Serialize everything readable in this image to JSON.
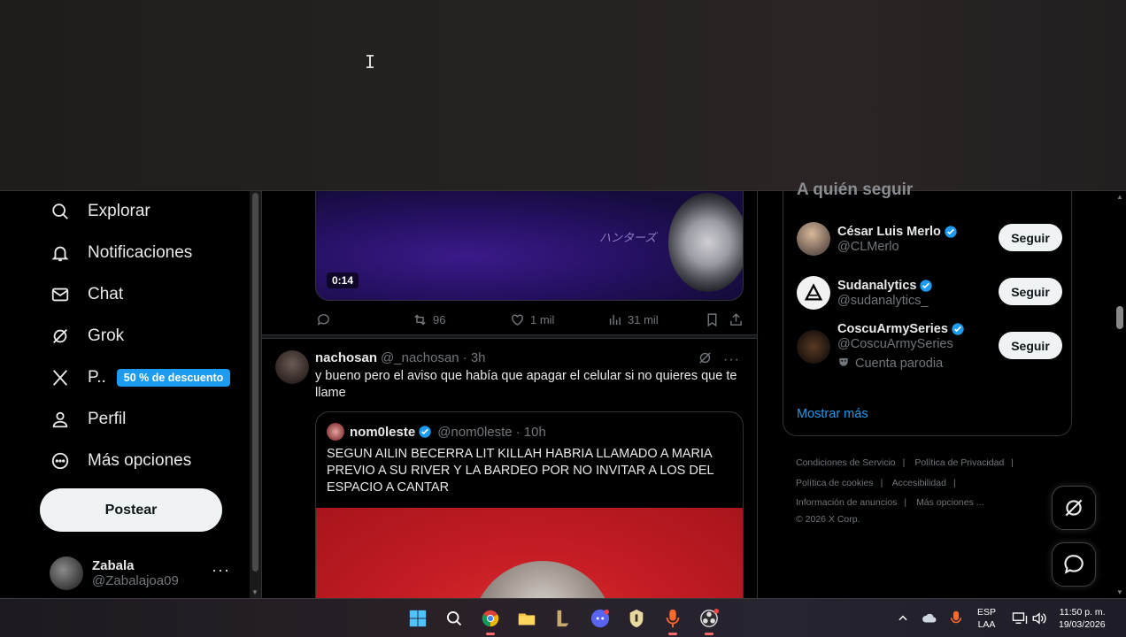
{
  "nav": {
    "items": [
      {
        "label": "Explorar",
        "icon": "search-icon"
      },
      {
        "label": "Notificaciones",
        "icon": "bell-icon"
      },
      {
        "label": "Chat",
        "icon": "mail-icon"
      },
      {
        "label": "Grok",
        "icon": "grok-icon"
      },
      {
        "label": "P..",
        "icon": "x-logo-icon",
        "badge": "50 % de descuento"
      },
      {
        "label": "Perfil",
        "icon": "person-icon"
      },
      {
        "label": "Más opciones",
        "icon": "more-circle-icon"
      }
    ],
    "post_button": "Postear",
    "user": {
      "name": "Zabala",
      "handle": "@Zabalajoa09",
      "more": "···"
    }
  },
  "feed": {
    "video_tweet": {
      "duration": "0:14",
      "video_text": "ハンターズ",
      "retweets": "96",
      "likes": "1 mil",
      "views": "31 mil"
    },
    "tweet": {
      "name": "nachosan",
      "handle": "@_nachosan",
      "time": "· 3h",
      "text": "y bueno pero el aviso que había que apagar el celular si no quieres que te llame",
      "quote": {
        "name": "nom0leste",
        "handle": "@nom0leste",
        "time": "· 10h",
        "text": "SEGUN AILIN BECERRA LIT KILLAH HABRIA LLAMADO A MARIA PREVIO A SU RIVER Y LA BARDEO POR NO INVITAR A LOS DEL ESPACIO A CANTAR"
      }
    }
  },
  "right": {
    "who_to_follow_title": "A quién seguir",
    "accounts": [
      {
        "name": "César Luis Merlo",
        "handle": "@CLMerlo",
        "verified": true,
        "button": "Seguir"
      },
      {
        "name": "Sudanalytics",
        "handle": "@sudanalytics_",
        "verified": true,
        "button": "Seguir"
      },
      {
        "name": "CoscuArmySeries",
        "handle": "@CoscuArmySeries",
        "verified": true,
        "parody": "Cuenta parodia",
        "button": "Seguir"
      }
    ],
    "show_more": "Mostrar más",
    "footer": {
      "links_row1": [
        "Condiciones de Servicio",
        "Política de Privacidad"
      ],
      "links_row2": [
        "Política de cookies",
        "Accesibilidad"
      ],
      "links_row3": [
        "Información de anuncios",
        "Más opciones ..."
      ],
      "copyright": "© 2026 X Corp."
    }
  },
  "taskbar": {
    "apps": [
      "windows-start-icon",
      "search-icon",
      "chrome-icon",
      "file-explorer-icon",
      "league-icon",
      "discord-icon",
      "valorant-icon",
      "microphone-app-icon",
      "obs-icon"
    ],
    "language": {
      "line1": "ESP",
      "line2": "LAA"
    },
    "time": "11:50 p. m.",
    "date": "19/03/2026"
  },
  "colors": {
    "accent": "#1d9bf0",
    "background": "#000000",
    "text": "#e7e9ea",
    "muted": "#71767b"
  }
}
